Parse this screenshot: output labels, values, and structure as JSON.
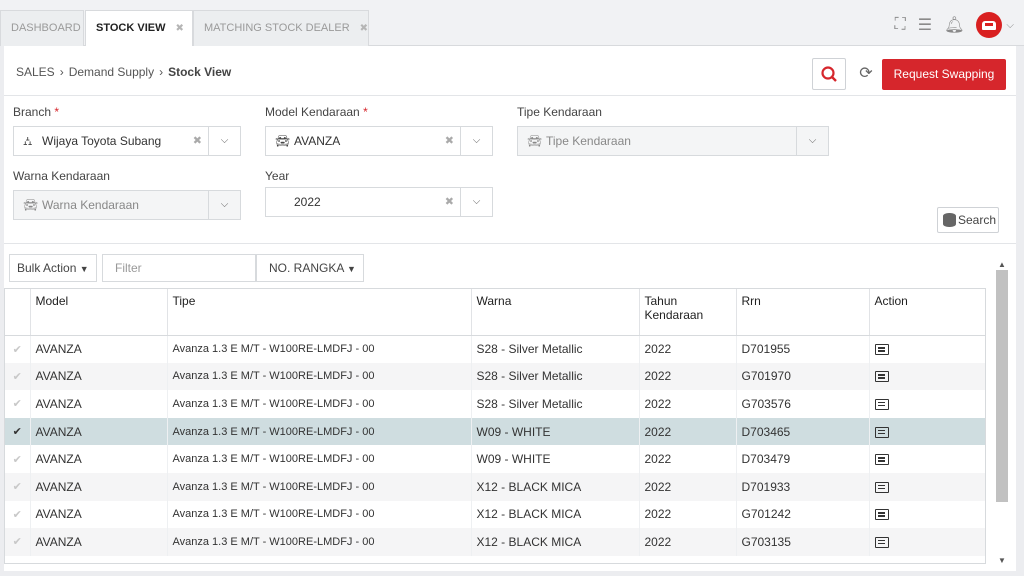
{
  "tabs": [
    {
      "label": "DASHBOARD",
      "closable": false,
      "active": false
    },
    {
      "label": "STOCK VIEW",
      "closable": true,
      "active": true
    },
    {
      "label": "MATCHING STOCK DEALER",
      "closable": true,
      "active": false
    }
  ],
  "breadcrumb": [
    "SALES",
    "Demand Supply",
    "Stock View"
  ],
  "actions": {
    "request_label": "Request Swapping"
  },
  "filters": {
    "branch": {
      "label": "Branch",
      "value": "Wijaya Toyota Subang"
    },
    "model": {
      "label": "Model Kendaraan",
      "value": "AVANZA"
    },
    "tipe": {
      "label": "Tipe Kendaraan",
      "placeholder": "Tipe Kendaraan"
    },
    "warna": {
      "label": "Warna Kendaraan",
      "placeholder": "Warna Kendaraan"
    },
    "year": {
      "label": "Year",
      "value": "2022"
    },
    "search_label": "Search"
  },
  "toolbar": {
    "bulk_action": "Bulk Action",
    "filter_placeholder": "Filter",
    "column_select": "NO. RANGKA"
  },
  "table": {
    "columns": [
      "Model",
      "Tipe",
      "Warna",
      "Tahun Kendaraan",
      "Rrn",
      "Action"
    ],
    "rows": [
      {
        "model": "AVANZA",
        "tipe": "Avanza 1.3 E M/T - W100RE-LMDFJ - 00",
        "warna": "S28 - Silver Metallic",
        "tahun": "2022",
        "rrn": "D701955",
        "selected": false
      },
      {
        "model": "AVANZA",
        "tipe": "Avanza 1.3 E M/T - W100RE-LMDFJ - 00",
        "warna": "S28 - Silver Metallic",
        "tahun": "2022",
        "rrn": "G701970",
        "selected": false
      },
      {
        "model": "AVANZA",
        "tipe": "Avanza 1.3 E M/T - W100RE-LMDFJ - 00",
        "warna": "S28 - Silver Metallic",
        "tahun": "2022",
        "rrn": "G703576",
        "selected": false
      },
      {
        "model": "AVANZA",
        "tipe": "Avanza 1.3 E M/T - W100RE-LMDFJ - 00",
        "warna": "W09 - WHITE",
        "tahun": "2022",
        "rrn": "D703465",
        "selected": true
      },
      {
        "model": "AVANZA",
        "tipe": "Avanza 1.3 E M/T - W100RE-LMDFJ - 00",
        "warna": "W09 - WHITE",
        "tahun": "2022",
        "rrn": "D703479",
        "selected": false
      },
      {
        "model": "AVANZA",
        "tipe": "Avanza 1.3 E M/T - W100RE-LMDFJ - 00",
        "warna": "X12 - BLACK MICA",
        "tahun": "2022",
        "rrn": "D701933",
        "selected": false
      },
      {
        "model": "AVANZA",
        "tipe": "Avanza 1.3 E M/T - W100RE-LMDFJ - 00",
        "warna": "X12 - BLACK MICA",
        "tahun": "2022",
        "rrn": "G701242",
        "selected": false
      },
      {
        "model": "AVANZA",
        "tipe": "Avanza 1.3 E M/T - W100RE-LMDFJ - 00",
        "warna": "X12 - BLACK MICA",
        "tahun": "2022",
        "rrn": "G703135",
        "selected": false
      }
    ]
  },
  "icons": {
    "row_action": "document-list-icon",
    "selected_row": "checkmark-icon"
  },
  "colors": {
    "accent": "#d6262c",
    "selected_row": "#cfdde0"
  }
}
